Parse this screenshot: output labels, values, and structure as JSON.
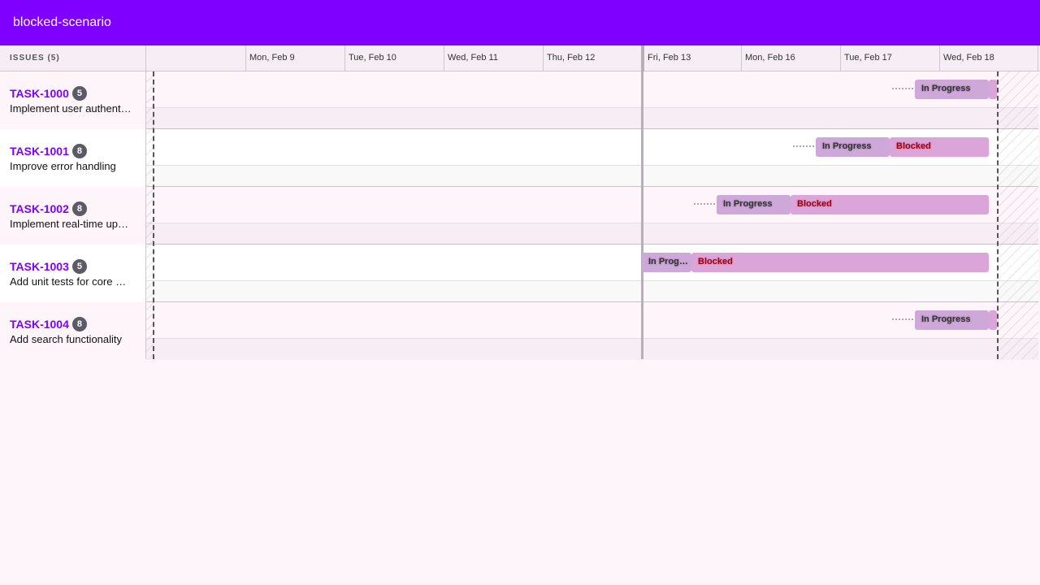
{
  "app": {
    "title": "blocked-scenario"
  },
  "issues_header": "ISSUES (5)",
  "dates": [
    "",
    "Mon, Feb 9",
    "Tue, Feb 10",
    "Wed, Feb 11",
    "Thu, Feb 12",
    "Fri, Feb 13",
    "Mon, Feb 16",
    "Tue, Feb 17",
    "Wed, Feb 18"
  ],
  "issues": [
    {
      "key": "TASK-1000",
      "points": "5",
      "summary": "Implement user authentication",
      "bars": [
        {
          "status": "In Progress"
        }
      ]
    },
    {
      "key": "TASK-1001",
      "points": "8",
      "summary": "Improve error handling",
      "bars": [
        {
          "status": "In Progress"
        },
        {
          "status": "Blocked"
        }
      ]
    },
    {
      "key": "TASK-1002",
      "points": "8",
      "summary": "Implement real-time updates",
      "bars": [
        {
          "status": "In Progress"
        },
        {
          "status": "Blocked"
        }
      ]
    },
    {
      "key": "TASK-1003",
      "points": "5",
      "summary": "Add unit tests for core modules",
      "bars": [
        {
          "status": "In Progress"
        },
        {
          "status": "Blocked"
        }
      ]
    },
    {
      "key": "TASK-1004",
      "points": "8",
      "summary": "Add search functionality",
      "bars": [
        {
          "status": "In Progress"
        }
      ]
    }
  ],
  "colors": {
    "appbar": "#8000ff",
    "issue_key": "#8000ff",
    "in_progress_bar": "#cfa8da",
    "blocked_bar": "#dca5da",
    "blocked_text": "#9a0010"
  }
}
